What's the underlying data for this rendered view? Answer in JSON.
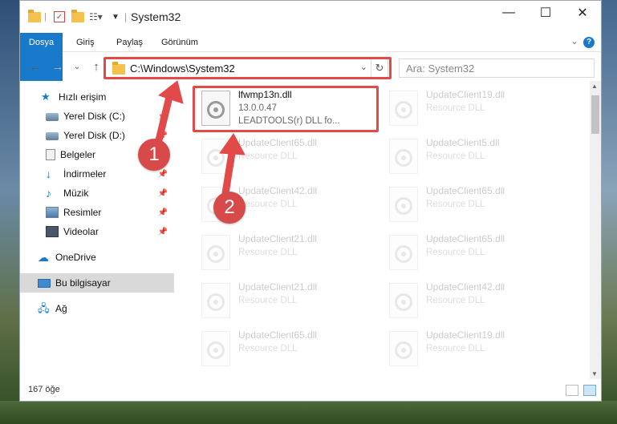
{
  "window": {
    "title": "System32",
    "controls": {
      "minimize": "—",
      "maximize": "☐",
      "close": "✕"
    }
  },
  "ribbon": {
    "tabs": [
      "Dosya",
      "Giriş",
      "Paylaş",
      "Görünüm"
    ],
    "help": "?"
  },
  "nav": {
    "address": "C:\\Windows\\System32",
    "search_placeholder": "Ara: System32"
  },
  "sidebar": {
    "quick_access": "Hızlı erişim",
    "items": [
      {
        "label": "Yerel Disk (C:)",
        "icon": "drive-icon"
      },
      {
        "label": "Yerel Disk (D:)",
        "icon": "drive-icon"
      },
      {
        "label": "Belgeler",
        "icon": "documents-icon"
      },
      {
        "label": "İndirmeler",
        "icon": "download-icon"
      },
      {
        "label": "Müzik",
        "icon": "music-icon"
      },
      {
        "label": "Resimler",
        "icon": "pictures-icon"
      },
      {
        "label": "Videolar",
        "icon": "videos-icon"
      }
    ],
    "onedrive": "OneDrive",
    "this_pc": "Bu bilgisayar",
    "network": "Ağ"
  },
  "files": {
    "highlighted": {
      "name": "lfwmp13n.dll",
      "version": "13.0.0.47",
      "description": "LEADTOOLS(r) DLL fo..."
    },
    "ghost": [
      {
        "name": "UpdateClient19.dll",
        "type": "Resource DLL"
      },
      {
        "name": "UpdateClient65.dll",
        "type": "Resource DLL"
      },
      {
        "name": "UpdateClient5.dll",
        "type": "Resource DLL"
      },
      {
        "name": "UpdateClient42.dll",
        "type": "Resource DLL"
      },
      {
        "name": "UpdateClient65.dll",
        "type": "Resource DLL"
      },
      {
        "name": "UpdateClient21.dll",
        "type": "Resource DLL"
      },
      {
        "name": "UpdateClient65.dll",
        "type": "Resource DLL"
      },
      {
        "name": "UpdateClient21.dll",
        "type": "Resource DLL"
      },
      {
        "name": "UpdateClient42.dll",
        "type": "Resource DLL"
      },
      {
        "name": "UpdateClient65.dll",
        "type": "Resource DLL"
      },
      {
        "name": "UpdateClient19.dll",
        "type": "Resource DLL"
      }
    ]
  },
  "status": {
    "count": "167 öğe"
  },
  "annotations": {
    "step1": "1",
    "step2": "2",
    "color": "#e24a4a"
  }
}
